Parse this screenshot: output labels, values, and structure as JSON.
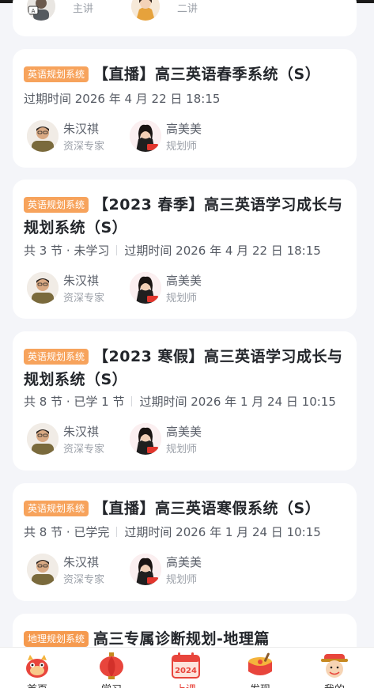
{
  "top_card": {
    "teacher_role": "主讲",
    "planner_role": "二讲"
  },
  "courses": [
    {
      "tag": "英语规划系统",
      "title": "【直播】高三英语春季系统（S）",
      "meta_lessons": "",
      "meta_expiry": "过期时间 2026 年 4 月 22 日 18:15",
      "teacher_name": "朱汉祺",
      "teacher_role": "资深专家",
      "planner_name": "高美美",
      "planner_role": "规划师"
    },
    {
      "tag": "英语规划系统",
      "title": "【2023 春季】高三英语学习成长与规划系统（S）",
      "meta_lessons": "共 3 节 · 未学习",
      "meta_expiry": "过期时间 2026 年 4 月 22 日 18:15",
      "teacher_name": "朱汉祺",
      "teacher_role": "资深专家",
      "planner_name": "高美美",
      "planner_role": "规划师"
    },
    {
      "tag": "英语规划系统",
      "title": "【2023 寒假】高三英语学习成长与规划系统（S）",
      "meta_lessons": "共 8 节 · 已学 1 节",
      "meta_expiry": "过期时间 2026 年 1 月 24 日 10:15",
      "teacher_name": "朱汉祺",
      "teacher_role": "资深专家",
      "planner_name": "高美美",
      "planner_role": "规划师"
    },
    {
      "tag": "英语规划系统",
      "title": "【直播】高三英语寒假系统（S）",
      "meta_lessons": "共 8 节 · 已学完",
      "meta_expiry": "过期时间 2026 年 1 月 24 日 10:15",
      "teacher_name": "朱汉祺",
      "teacher_role": "资深专家",
      "planner_name": "高美美",
      "planner_role": "规划师"
    },
    {
      "tag": "地理规划系统",
      "title": "高三专属诊断规划-地理篇"
    }
  ],
  "tabbar": [
    {
      "label": "首页",
      "icon": "dragon-icon"
    },
    {
      "label": "学习",
      "icon": "lantern-icon"
    },
    {
      "label": "上课",
      "icon": "calendar-2024-icon",
      "badge": "2024",
      "active": true
    },
    {
      "label": "发现",
      "icon": "drum-icon"
    },
    {
      "label": "我的",
      "icon": "fortune-god-icon"
    }
  ],
  "colors": {
    "accent": "#e8453c",
    "tag_bg": "#f7a35c",
    "page_bg": "#f4f5f9"
  }
}
